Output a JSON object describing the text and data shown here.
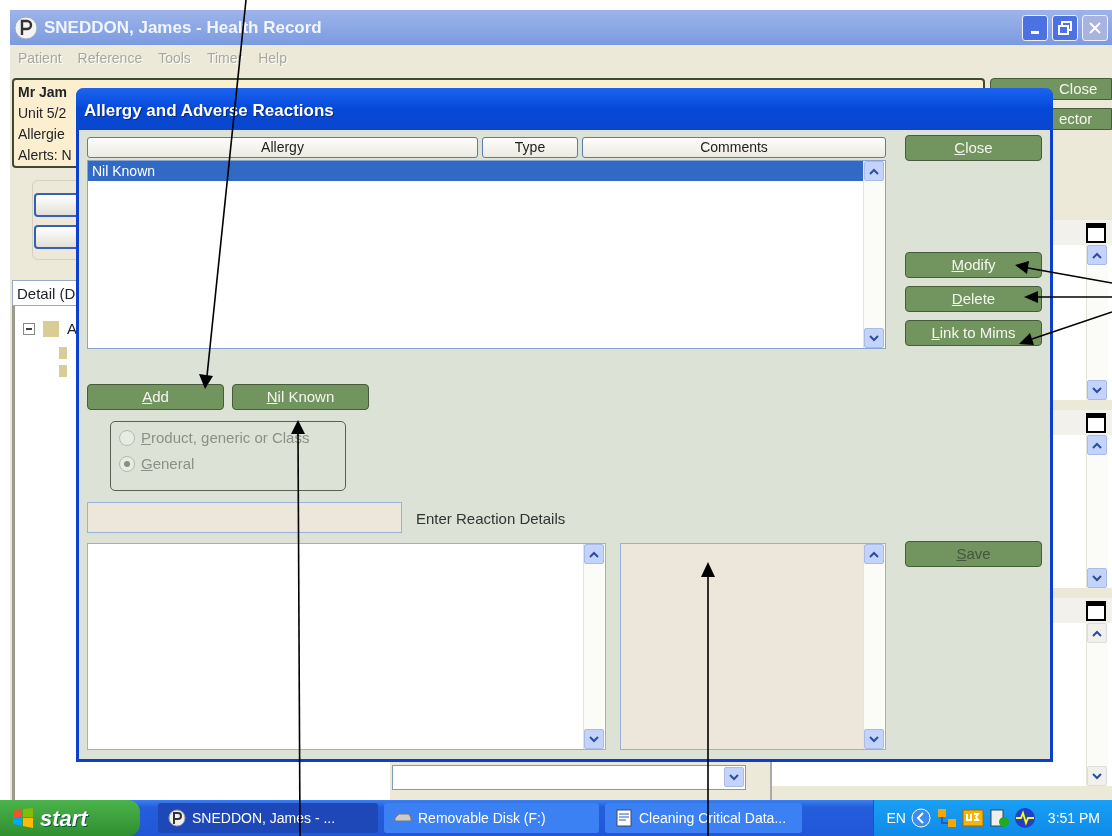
{
  "window": {
    "title": "SNEDDON, James  -  Health Record",
    "controls": [
      {
        "kind": "minimize",
        "disabled": false
      },
      {
        "kind": "restore",
        "disabled": false
      },
      {
        "kind": "close",
        "disabled": true
      }
    ]
  },
  "menu": [
    {
      "label": "Patient",
      "disabled": true
    },
    {
      "label": "Reference",
      "disabled": true
    },
    {
      "label": "Tools",
      "disabled": true
    },
    {
      "label": "Timer",
      "disabled": true
    },
    {
      "label": "Help",
      "disabled": true
    }
  ],
  "patient_banner": {
    "lines": [
      {
        "text": "Mr Jam",
        "kind": "name"
      },
      {
        "text": "Unit 5/2",
        "kind": "plain"
      },
      {
        "text": "Allergie",
        "kind": "plain"
      },
      {
        "text": "Alerts: N",
        "kind": "plain"
      }
    ]
  },
  "banner_buttons": [
    {
      "label": "Close"
    },
    {
      "label": "ector"
    }
  ],
  "detail_tab": {
    "label": "Detail (D"
  },
  "tree": [
    {
      "label": "A",
      "expanded": true,
      "children": [
        {
          "kind": "folder"
        },
        {
          "kind": "folder"
        }
      ]
    }
  ],
  "dialog": {
    "title": "Allergy and Adverse Reactions",
    "columns": [
      "Allergy",
      "Type",
      "Comments"
    ],
    "rows": [
      {
        "allergy": "Nil Known",
        "selected": true
      }
    ],
    "side_buttons": [
      {
        "label": "Close",
        "disabled": false
      },
      {
        "label": "Modify",
        "disabled": false
      },
      {
        "label": "Delete",
        "disabled": false
      },
      {
        "label": "Link to Mims",
        "disabled": false
      }
    ],
    "action_buttons": [
      {
        "label": "Add",
        "disabled": false
      },
      {
        "label": "Nil Known",
        "disabled": false
      }
    ],
    "radio_group": [
      {
        "label": "Product, generic or Class",
        "selected": false,
        "disabled": true
      },
      {
        "label": "General",
        "selected": true,
        "disabled": true
      }
    ],
    "name_field": {
      "disabled": true
    },
    "reaction_label": "Enter Reaction Details",
    "reaction_field": {
      "disabled": true
    },
    "save_button": {
      "label": "Save",
      "disabled": true
    }
  },
  "taskbar": {
    "start": "start",
    "tasks": [
      {
        "label": "SNEDDON, James  -  ...",
        "kind": "app",
        "selected": true
      },
      {
        "label": "Removable Disk (F:)",
        "kind": "drive",
        "selected": false
      },
      {
        "label": "Cleaning Critical Data...",
        "kind": "document",
        "selected": false
      }
    ],
    "language": "EN",
    "clock": "3:51 PM"
  }
}
